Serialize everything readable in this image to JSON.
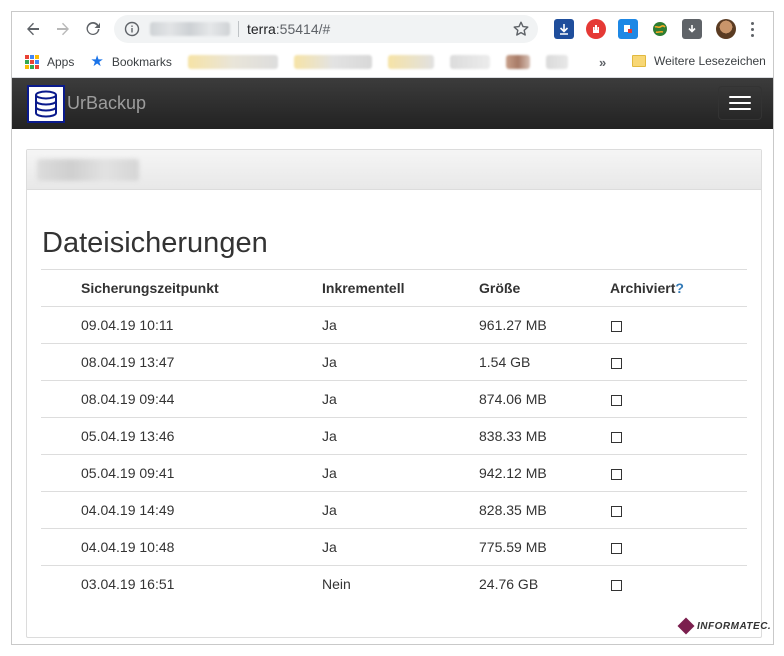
{
  "browser": {
    "address": {
      "host": "terra",
      "port": ":55414/#"
    },
    "extension_colors": [
      "#1f4e9c",
      "#e53935",
      "#1e88e5",
      "#2e7d32",
      "#5f6368"
    ],
    "bookmarks_bar": {
      "apps_label": "Apps",
      "bookmarks_label": "Bookmarks",
      "overflow": "»",
      "other_bookmarks_label": "Weitere Lesezeichen"
    }
  },
  "app": {
    "brand": "UrBackup",
    "accent_color": "#0a1a8c"
  },
  "page": {
    "title": "Dateisicherungen",
    "columns": {
      "time": "Sicherungszeitpunkt",
      "incremental": "Inkrementell",
      "size": "Größe",
      "archived": "Archiviert",
      "archived_help": "?"
    },
    "rows": [
      {
        "time": "09.04.19 10:11",
        "incremental": "Ja",
        "size": "961.27 MB",
        "archived": false
      },
      {
        "time": "08.04.19 13:47",
        "incremental": "Ja",
        "size": "1.54 GB",
        "archived": false
      },
      {
        "time": "08.04.19 09:44",
        "incremental": "Ja",
        "size": "874.06 MB",
        "archived": false
      },
      {
        "time": "05.04.19 13:46",
        "incremental": "Ja",
        "size": "838.33 MB",
        "archived": false
      },
      {
        "time": "05.04.19 09:41",
        "incremental": "Ja",
        "size": "942.12 MB",
        "archived": false
      },
      {
        "time": "04.04.19 14:49",
        "incremental": "Ja",
        "size": "828.35 MB",
        "archived": false
      },
      {
        "time": "04.04.19 10:48",
        "incremental": "Ja",
        "size": "775.59 MB",
        "archived": false
      },
      {
        "time": "03.04.19 16:51",
        "incremental": "Nein",
        "size": "24.76 GB",
        "archived": false
      }
    ]
  },
  "watermark": {
    "text": "INFORMATEC."
  }
}
